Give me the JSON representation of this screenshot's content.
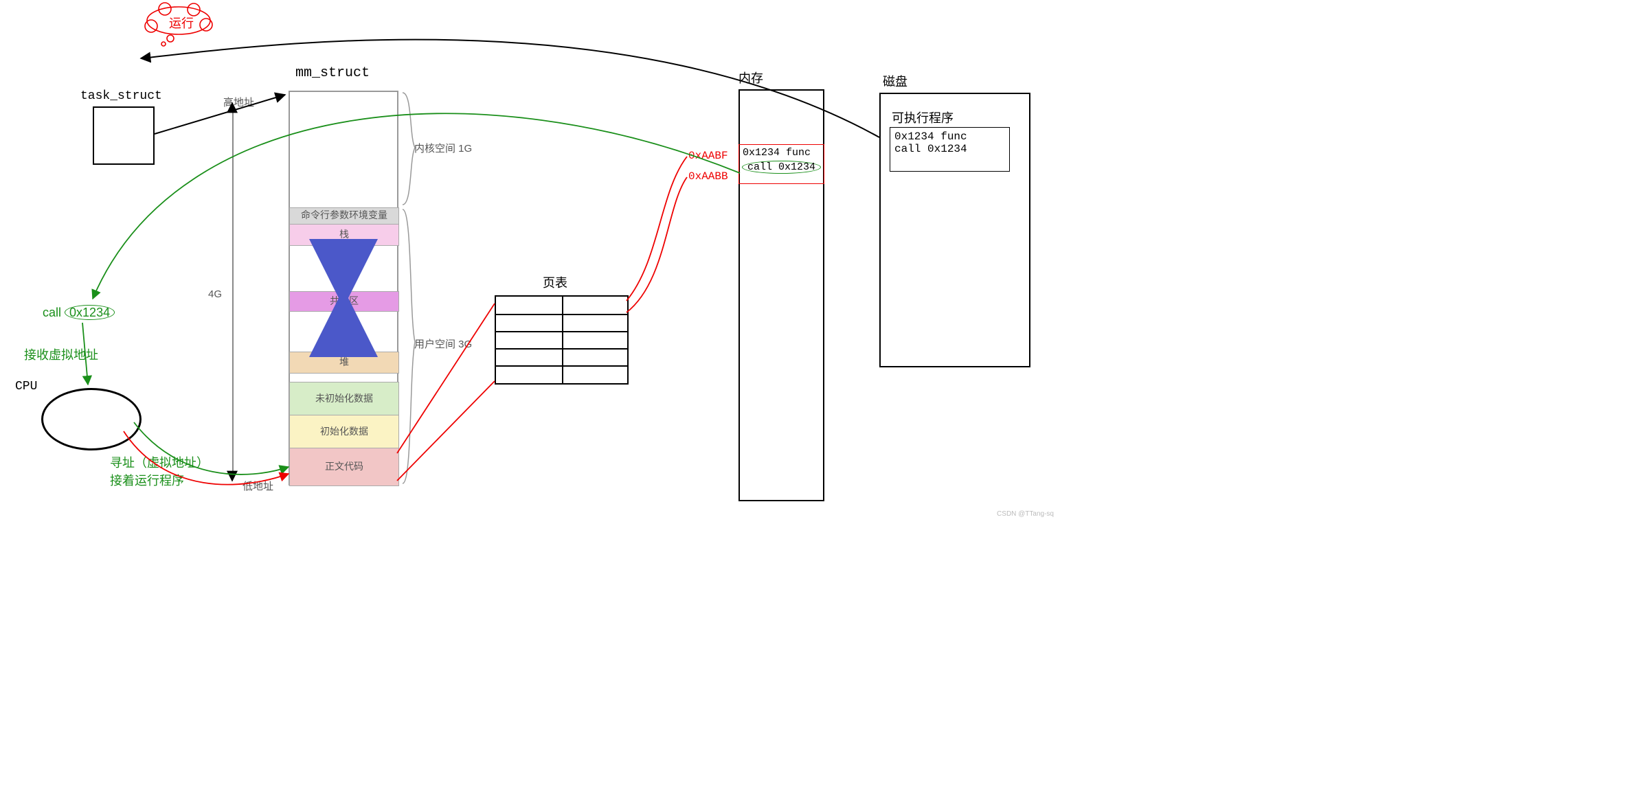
{
  "task_struct": {
    "title": "task_struct"
  },
  "mm_struct": {
    "title": "mm_struct",
    "high_addr": "高地址",
    "low_addr": "低地址",
    "size": "4G",
    "kernel_label": "内核空间 1G",
    "user_label": "用户空间 3G",
    "rows": {
      "args": "命令行参数环境变量",
      "stack": "栈",
      "shared": "共享区",
      "heap": "堆",
      "bss": "未初始化数据",
      "data": "初始化数据",
      "text": "正文代码"
    }
  },
  "cpu": {
    "label": "CPU",
    "call": "call",
    "addr": "0x1234",
    "recv": "接收虚拟地址",
    "lookup": "寻址（虚拟地址）\n接着运行程序"
  },
  "pagetable": {
    "title": "页表"
  },
  "memory": {
    "title": "内存",
    "rows": [
      {
        "addr": "0xAABF",
        "text": "0x1234 func"
      },
      {
        "addr": "0xAABB",
        "text": "call  0x1234"
      }
    ]
  },
  "disk": {
    "title": "磁盘",
    "exec": "可执行程序",
    "lines": [
      "0x1234  func",
      "call    0x1234"
    ]
  },
  "run": "运行",
  "watermark": "CSDN @TTang-sq"
}
